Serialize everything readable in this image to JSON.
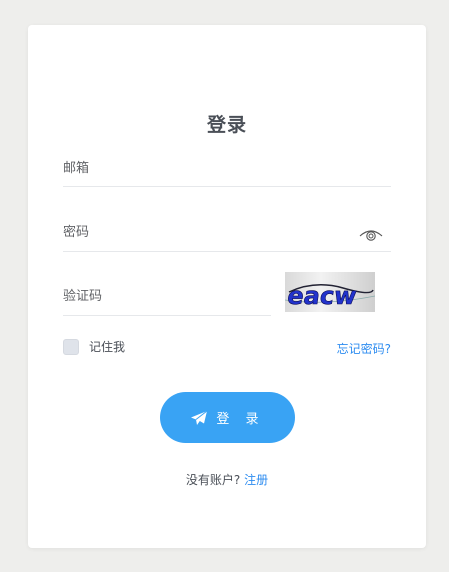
{
  "login": {
    "title": "登录",
    "email": {
      "placeholder": "邮箱",
      "value": ""
    },
    "password": {
      "placeholder": "密码",
      "value": "",
      "toggle_icon": "eye-icon"
    },
    "captcha": {
      "placeholder": "验证码",
      "value": "",
      "image_text": "eacw"
    },
    "remember_label": "记住我",
    "remember_checked": false,
    "forgot_label": "忘记密码?",
    "submit_label": "登 录",
    "submit_icon": "paper-plane-icon",
    "no_account_text": "没有账户?",
    "register_label": "注册"
  },
  "colors": {
    "background": "#eeeeec",
    "card": "#ffffff",
    "primary_button": "#39a3f4",
    "link": "#2d8cf0",
    "text": "#4a4f57"
  }
}
